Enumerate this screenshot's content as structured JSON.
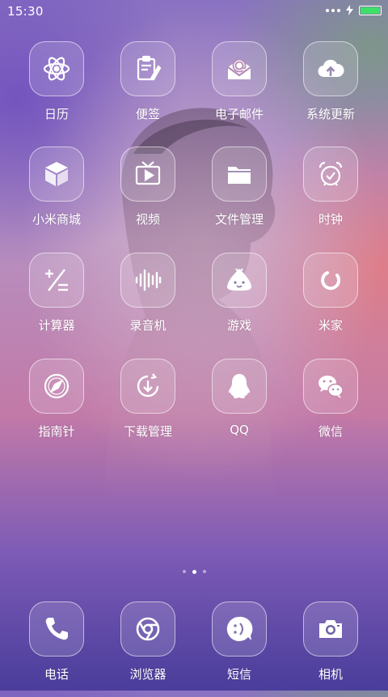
{
  "status_bar": {
    "time": "15:30",
    "battery_percent": 100,
    "battery_color": "#3ee06a"
  },
  "apps": [
    {
      "label": "日历",
      "icon": "atom-icon"
    },
    {
      "label": "便签",
      "icon": "notepad-icon"
    },
    {
      "label": "电子邮件",
      "icon": "mail-icon"
    },
    {
      "label": "系统更新",
      "icon": "cloud-upload-icon"
    },
    {
      "label": "小米商城",
      "icon": "cube-icon"
    },
    {
      "label": "视频",
      "icon": "tv-play-icon"
    },
    {
      "label": "文件管理",
      "icon": "folder-icon"
    },
    {
      "label": "时钟",
      "icon": "alarm-clock-icon"
    },
    {
      "label": "计算器",
      "icon": "calculator-icon"
    },
    {
      "label": "录音机",
      "icon": "waveform-icon"
    },
    {
      "label": "游戏",
      "icon": "game-mascot-icon"
    },
    {
      "label": "米家",
      "icon": "mijia-ring-icon"
    },
    {
      "label": "指南针",
      "icon": "compass-icon"
    },
    {
      "label": "下载管理",
      "icon": "download-icon"
    },
    {
      "label": "QQ",
      "icon": "qq-penguin-icon"
    },
    {
      "label": "微信",
      "icon": "wechat-icon"
    }
  ],
  "page_indicator": {
    "count": 3,
    "active_index": 1
  },
  "dock": [
    {
      "label": "电话",
      "icon": "phone-icon"
    },
    {
      "label": "浏览器",
      "icon": "browser-icon"
    },
    {
      "label": "短信",
      "icon": "sms-icon"
    },
    {
      "label": "相机",
      "icon": "camera-icon"
    }
  ]
}
